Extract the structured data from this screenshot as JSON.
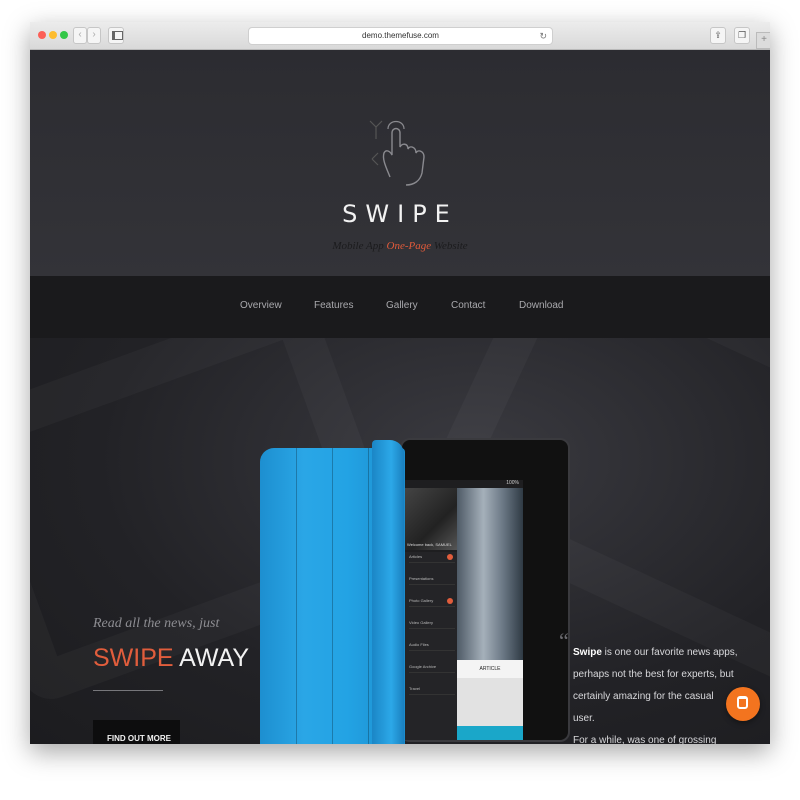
{
  "browser": {
    "url": "demo.themefuse.com",
    "back_glyph": "‹",
    "forward_glyph": "›",
    "reload_glyph": "↻",
    "share_glyph": "⇪",
    "tabs_glyph": "❐",
    "plus_glyph": "+",
    "icons": [
      "sidebar-icon",
      "reload-icon",
      "share-icon",
      "tabs-icon",
      "new-tab-icon"
    ]
  },
  "header": {
    "logo": "SWIPE",
    "tagline_start": "Mobile App ",
    "tagline_accent": "One-Page",
    "tagline_end": " Website"
  },
  "nav": {
    "items": [
      {
        "label": "Overview"
      },
      {
        "label": "Features"
      },
      {
        "label": "Gallery"
      },
      {
        "label": "Contact"
      },
      {
        "label": "Download"
      }
    ]
  },
  "hero": {
    "subtitle": "Read all the news, just",
    "headline_orange": "SWIPE",
    "headline_rest": " AWAY",
    "cta_label": "FIND OUT MORE"
  },
  "device_screen": {
    "status": "100%",
    "welcome": "Welcome back, SAMUEL",
    "menu": [
      {
        "label": "Articles"
      },
      {
        "label": "Presentations"
      },
      {
        "label": "Photo Gallery"
      },
      {
        "label": "Video Gallery"
      },
      {
        "label": "Audio Files"
      },
      {
        "label": "Google Archive"
      },
      {
        "label": "Travel"
      }
    ],
    "article_label": "ARTICLE"
  },
  "testimonial": {
    "quote_mark": "“",
    "brand": "Swipe",
    "line1": " is one our favorite news apps,",
    "line2": "perhaps not the best for experts, but",
    "line3": "certainly amazing for the casual user.",
    "line4": "For a while, was one of grossing apps."
  },
  "colors": {
    "accent": "#e15d3c",
    "case_blue": "#23a3e4",
    "chat_orange": "#f3741f"
  },
  "chat": {
    "icon": "chat-icon"
  }
}
